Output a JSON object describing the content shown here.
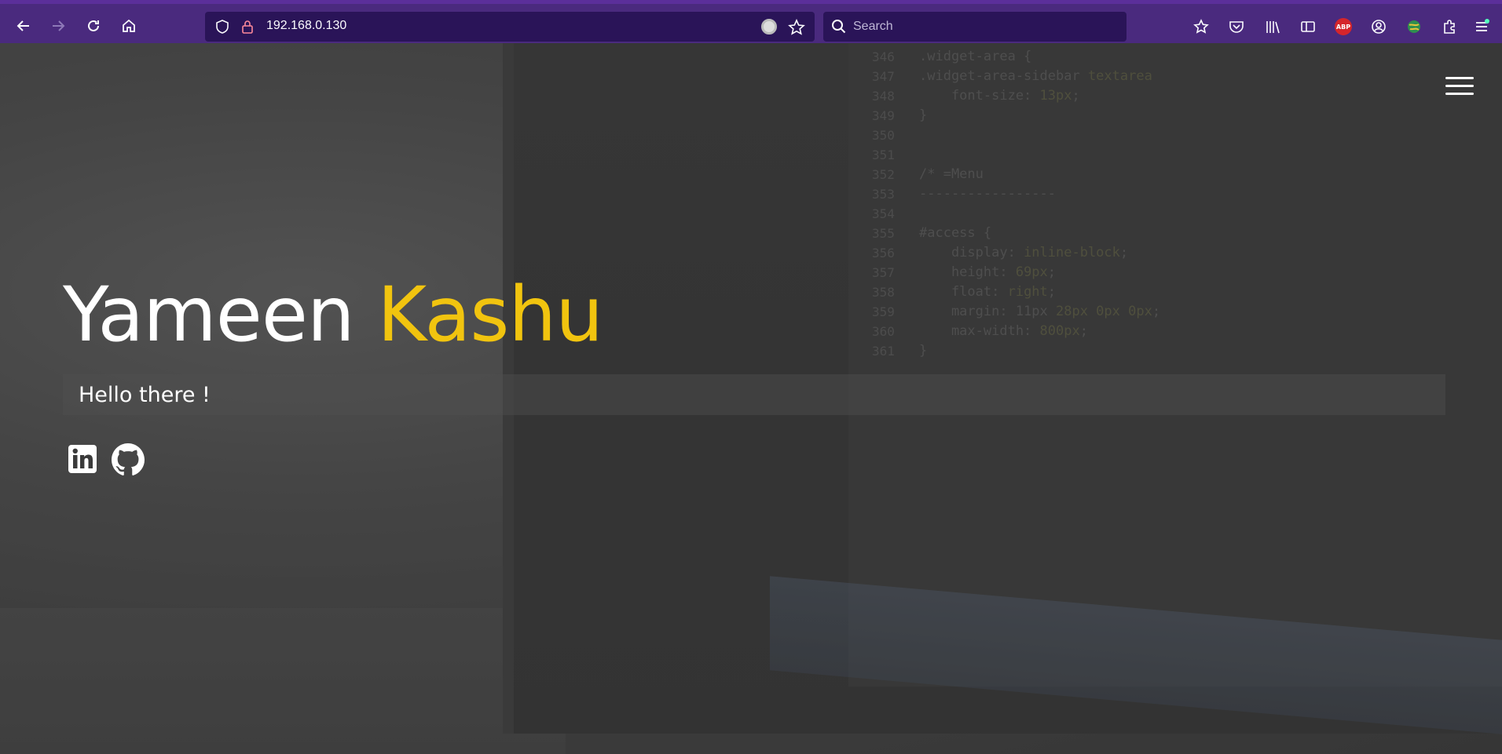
{
  "browser": {
    "url": "192.168.0.130",
    "search_placeholder": "Search",
    "abp_label": "ABP"
  },
  "page": {
    "first_name": "Yameen",
    "last_name": "Kashu",
    "greeting": "Hello there !",
    "accent_color": "#f1c40f",
    "social_links": [
      "linkedin-icon",
      "github-icon"
    ]
  }
}
